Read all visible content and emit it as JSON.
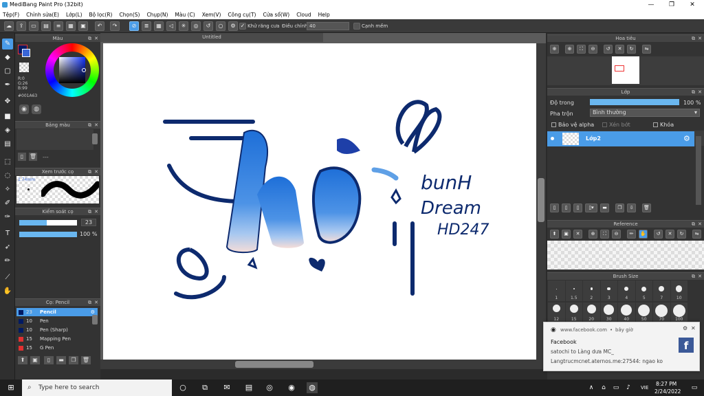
{
  "window": {
    "title": "MediBang Paint Pro (32bit)"
  },
  "menu": [
    "Tệp(F)",
    "Chỉnh sửa(E)",
    "Lớp(L)",
    "Bộ lọc(R)",
    "Chọn(S)",
    "Chụp(N)",
    "Màu (C)",
    "Xem(V)",
    "Công cụ(T)",
    "Cửa sổ(W)",
    "Cloud",
    "Help"
  ],
  "toolbar": {
    "antialias_label": "Khử răng cưa",
    "adjust_label": "Điều chỉnh",
    "adjust_value": "40",
    "smooth_label": "Cạnh mềm"
  },
  "color_panel": {
    "title": "Màu",
    "r": "R:0",
    "g": "G:26",
    "b": "B:99",
    "hex": "#001A63",
    "fg": "#001A63"
  },
  "palette_panel": {
    "title": "Bảng màu",
    "placeholder": "---"
  },
  "brush_preview": {
    "title": "Xem trước cọ",
    "size": "1.74mm"
  },
  "brush_control": {
    "title": "Kiểm soát cọ",
    "size_value": "23",
    "opacity_value": "100 %"
  },
  "brush_list": {
    "title": "Cọ: Pencil",
    "items": [
      {
        "size": "23",
        "name": "Pencil",
        "color": "#001A63",
        "selected": true
      },
      {
        "size": "10",
        "name": "Pen",
        "color": "#001A63",
        "selected": false
      },
      {
        "size": "10",
        "name": "Pen (Sharp)",
        "color": "#001A63",
        "selected": false
      },
      {
        "size": "15",
        "name": "Mapping Pen",
        "color": "#e03030",
        "selected": false
      },
      {
        "size": "15",
        "name": "G Pen",
        "color": "#e03030",
        "selected": false
      }
    ]
  },
  "document": {
    "tab": "Untitled"
  },
  "artwork": {
    "lines": [
      "bunH",
      "Dream",
      "HD247"
    ]
  },
  "navigator": {
    "title": "Hoa tiêu"
  },
  "layer_panel": {
    "title": "Lớp",
    "opacity_label": "Độ trong",
    "opacity_value": "100 %",
    "blend_label": "Pha trộn",
    "blend_value": "Bình thường",
    "protect_alpha": "Bảo vệ alpha",
    "clip": "Xén bớt",
    "lock": "Khóa",
    "layer_name": "Lớp2"
  },
  "reference": {
    "title": "Reference"
  },
  "brush_size": {
    "title": "Brush Size",
    "sizes": [
      "1",
      "1.5",
      "2",
      "3",
      "4",
      "5",
      "7",
      "10"
    ],
    "sizes2": [
      "12",
      "15",
      "20",
      "30",
      "40",
      "50",
      "70",
      "100"
    ]
  },
  "notification": {
    "source": "www.facebook.com",
    "time": "bây giờ",
    "app": "Facebook",
    "line1": "satochi to Làng dưa MC_",
    "line2": "Langtrucmcnet.aternos.me:27544: ngao ko"
  },
  "taskbar": {
    "search_placeholder": "Type here to search",
    "lang": "VIE",
    "time": "8:27 PM",
    "date": "2/24/2022"
  }
}
